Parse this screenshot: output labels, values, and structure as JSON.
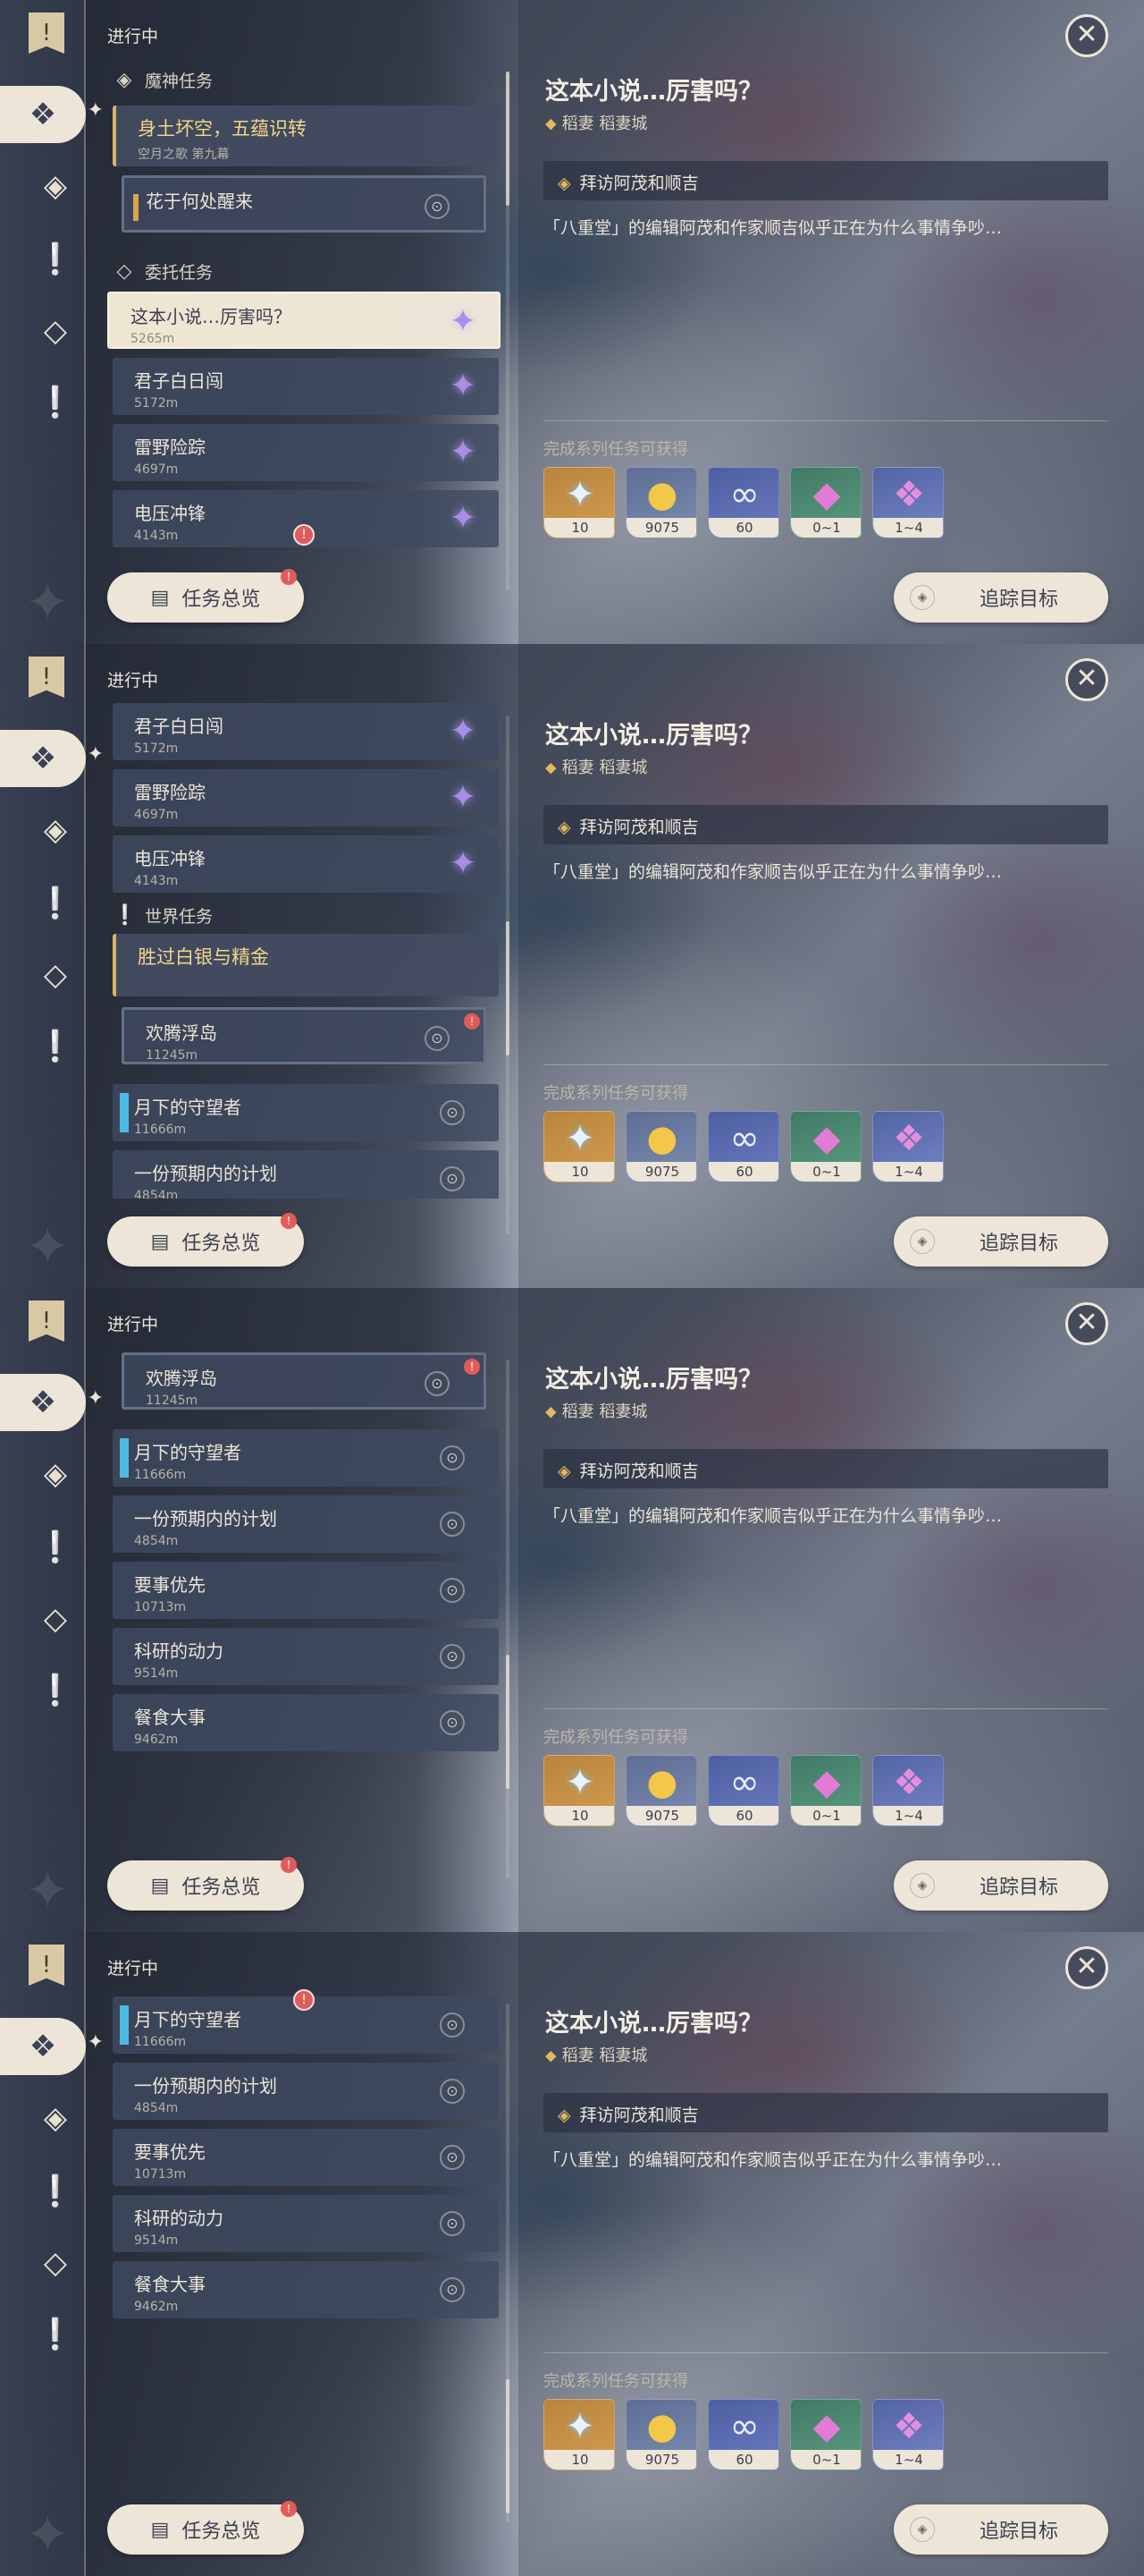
{
  "header": "进行中",
  "detail": {
    "title": "这本小说…厉害吗？",
    "location": "稻妻 稻妻城",
    "objective": "拜访阿茂和顺吉",
    "description": "「八重堂」的编辑阿茂和作家顺吉似乎正在为什么事情争吵…",
    "rewards_label": "完成系列任务可获得",
    "rewards": [
      {
        "icon": "primogem-icon",
        "count": "10"
      },
      {
        "icon": "mora-icon",
        "count": "9075"
      },
      {
        "icon": "fate-icon",
        "count": "60"
      },
      {
        "icon": "crystal-icon",
        "count": "0~1"
      },
      {
        "icon": "crystal-cluster-icon",
        "count": "1~4"
      }
    ]
  },
  "buttons": {
    "overview": "任务总览",
    "track": "追踪目标"
  },
  "quests": {
    "archon_section": "魔神任务",
    "archon_title": "身土坏空，五蕴识转",
    "archon_sub": "空月之歌 第九幕",
    "archon_child": "花于何处醒来",
    "commission_section": "委托任务",
    "world_section": "世界任务",
    "world_title": "胜过白银与精金",
    "c1": {
      "name": "这本小说…厉害吗？",
      "dist": "5265m"
    },
    "c2": {
      "name": "君子白日闯",
      "dist": "5172m"
    },
    "c3": {
      "name": "雷野险踪",
      "dist": "4697m"
    },
    "c4": {
      "name": "电压冲锋",
      "dist": "4143m"
    },
    "w1": {
      "name": "欢腾浮岛",
      "dist": "11245m"
    },
    "w2": {
      "name": "月下的守望者",
      "dist": "11666m"
    },
    "w3": {
      "name": "一份预期内的计划",
      "dist": "4854m"
    },
    "w4": {
      "name": "要事优先",
      "dist": "10713m"
    },
    "w5": {
      "name": "科研的动力",
      "dist": "9514m"
    },
    "w6": {
      "name": "餐食大事",
      "dist": "9462m"
    }
  }
}
